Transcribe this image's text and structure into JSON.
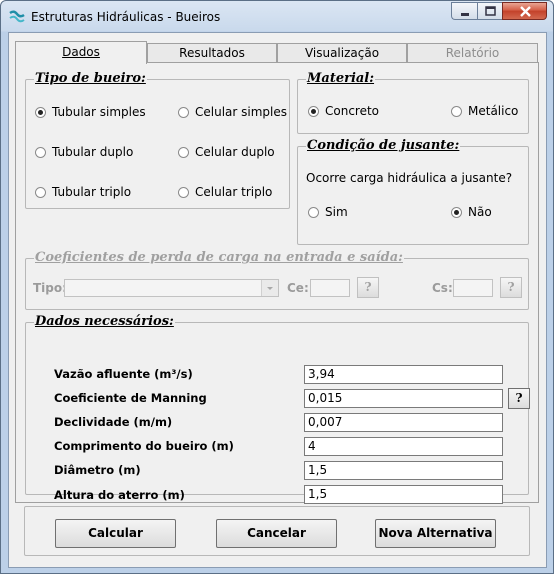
{
  "window": {
    "title": "Estruturas Hidráulicas - Bueiros"
  },
  "tabs": [
    {
      "label": "Dados",
      "active": true
    },
    {
      "label": "Resultados"
    },
    {
      "label": "Visualização"
    },
    {
      "label": "Relatório",
      "disabled": true
    }
  ],
  "tipo_bueiro": {
    "legend": "Tipo de bueiro:",
    "options": [
      "Tubular simples",
      "Celular simples",
      "Tubular duplo",
      "Celular duplo",
      "Tubular triplo",
      "Celular triplo"
    ],
    "selected": "Tubular simples"
  },
  "material": {
    "legend": "Material:",
    "options": [
      "Concreto",
      "Metálico"
    ],
    "selected": "Concreto"
  },
  "jusante": {
    "legend": "Condição de jusante:",
    "question": "Ocorre carga hidráulica a jusante?",
    "options": [
      "Sim",
      "Não"
    ],
    "selected": "Não"
  },
  "coeficientes": {
    "legend": "Coeficientes de perda de carga na entrada e saída:",
    "tipo_label": "Tipo:",
    "ce_label": "Ce:",
    "cs_label": "Cs:",
    "help": "?"
  },
  "dados": {
    "legend": "Dados necessários:",
    "fields": [
      {
        "label": "Vazão afluente (m³/s)",
        "value": "3,94"
      },
      {
        "label": "Coeficiente de Manning",
        "value": "0,015"
      },
      {
        "label": "Declividade (m/m)",
        "value": "0,007"
      },
      {
        "label": "Comprimento do bueiro (m)",
        "value": "4"
      },
      {
        "label": "Diâmetro (m)",
        "value": "1,5"
      },
      {
        "label": "Altura do aterro (m)",
        "value": "1,5"
      }
    ],
    "help": "?"
  },
  "buttons": {
    "calcular": "Calcular",
    "cancelar": "Cancelar",
    "nova": "Nova Alternativa"
  },
  "colors": {
    "titlebar": "#c9d9ec",
    "panel": "#f0f0f0",
    "close": "#c3412a"
  }
}
